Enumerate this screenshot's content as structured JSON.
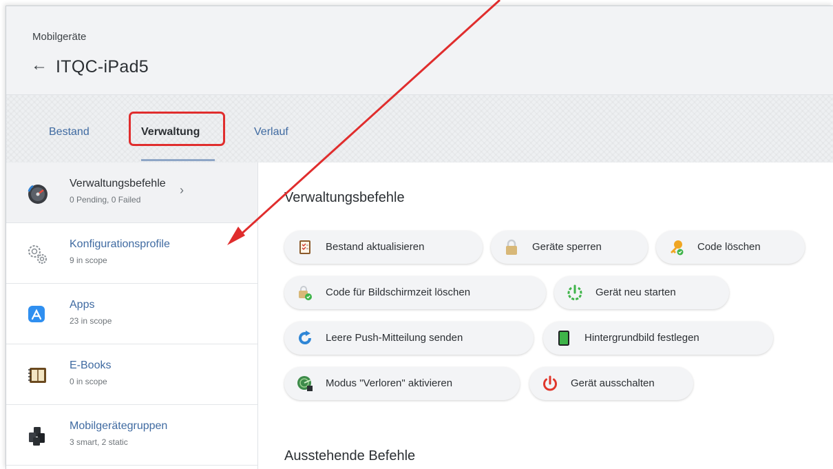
{
  "header": {
    "breadcrumb": "Mobilgeräte",
    "back_arrow": "←",
    "title": "ITQC-iPad5"
  },
  "tabs": [
    {
      "label": "Bestand"
    },
    {
      "label": "Verwaltung",
      "active": true
    },
    {
      "label": "Verlauf"
    }
  ],
  "sidebar": {
    "items": [
      {
        "label": "Verwaltungsbefehle",
        "sub": "0 Pending, 0 Failed",
        "icon": "management-commands-icon",
        "selected": true
      },
      {
        "label": "Konfigurationsprofile",
        "sub": "9 in scope",
        "icon": "gears-icon"
      },
      {
        "label": "Apps",
        "sub": "23 in scope",
        "icon": "app-store-icon"
      },
      {
        "label": "E-Books",
        "sub": "0 in scope",
        "icon": "ebook-icon"
      },
      {
        "label": "Mobilgerätegruppen",
        "sub": "3 smart, 2 static",
        "icon": "device-groups-icon"
      }
    ],
    "chevron": "›"
  },
  "main": {
    "heading": "Verwaltungsbefehle",
    "commands": [
      {
        "label": "Bestand aktualisieren",
        "icon": "inventory-clipboard-icon"
      },
      {
        "label": "Geräte sperren",
        "icon": "padlock-icon"
      },
      {
        "label": "Code löschen",
        "icon": "key-icon"
      },
      {
        "label": "Code für Bildschirmzeit löschen",
        "icon": "screen-time-lock-icon"
      },
      {
        "label": "Gerät neu starten",
        "icon": "restart-icon"
      },
      {
        "label": "Leere Push-Mitteilung senden",
        "icon": "refresh-arrow-icon"
      },
      {
        "label": "Hintergrundbild festlegen",
        "icon": "tablet-icon"
      },
      {
        "label": "Modus \"Verloren\" aktivieren",
        "icon": "lost-mode-radar-icon"
      },
      {
        "label": "Gerät ausschalten",
        "icon": "power-icon"
      }
    ],
    "pending_heading": "Ausstehende Befehle"
  },
  "colors": {
    "accent_link": "#3f6aa1",
    "annotation_red": "#e02d2d"
  }
}
